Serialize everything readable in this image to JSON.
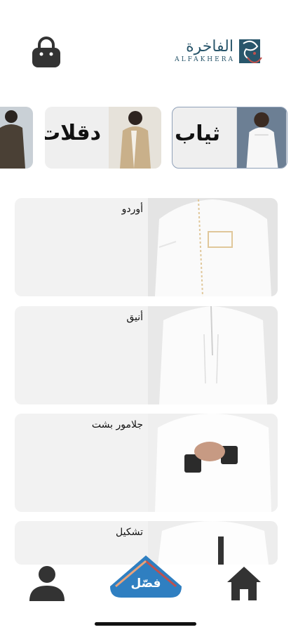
{
  "header": {
    "brand_ar": "الفاخرة",
    "brand_en": "ALFAKHERA",
    "bag_icon": "shopping-bag-icon",
    "colors": {
      "brand": "#29566b",
      "accent": "#c0504d"
    }
  },
  "categories": [
    {
      "label": "ثياب",
      "selected": true
    },
    {
      "label": "دقلات",
      "selected": false
    },
    {
      "label": "",
      "selected": false
    }
  ],
  "products": [
    {
      "name": "أوردو"
    },
    {
      "name": "أنيق"
    },
    {
      "name": "جلامور بشت"
    },
    {
      "name": "تشكيل"
    }
  ],
  "tabbar": {
    "profile_icon": "user-icon",
    "center_label": "فصّل",
    "home_icon": "home-icon",
    "center_color": "#2f7fc1"
  }
}
